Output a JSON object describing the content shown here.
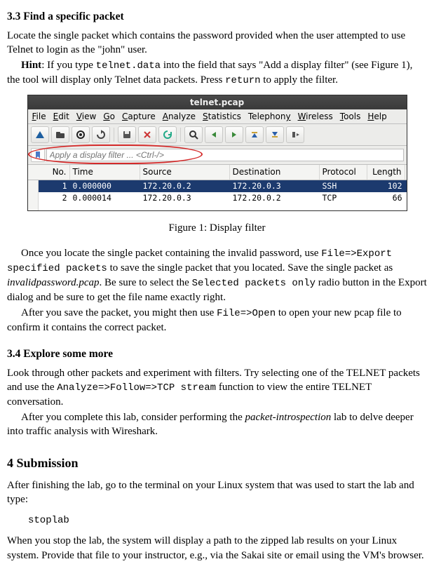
{
  "sec33": {
    "heading": "3.3   Find a specific packet",
    "p1a": "Locate the single packet which contains the password provided when the user attempted to use Telnet to login as the \"john\" user.",
    "p2_hint": "Hint",
    "p2a": ": If you type ",
    "p2_code": "telnet.data",
    "p2b": " into the field that says \"Add a display filter\" (see Figure 1), the tool will display only Telnet data packets. Press ",
    "p2_ret": "return",
    "p2c": " to apply the filter.",
    "p3a": "Once you locate the single packet containing the invalid password, use ",
    "p3_c1": "File=>Export specified packets",
    "p3b": " to save the single packet that you located.  Save the single packet as ",
    "p3_ital": "invalidpassword.pcap",
    "p3c": ".  Be sure to select the ",
    "p3_c2": "Selected packets only",
    "p3d": " radio button in the Export dialog and be sure to get the file name exactly right.",
    "p4a": "After you save the packet, you might then use ",
    "p4_c1": "File=>Open",
    "p4b": " to open your new pcap file to confirm it contains the correct packet."
  },
  "fig_caption": "Figure 1: Display filter",
  "sec34": {
    "heading": "3.4   Explore some more",
    "p1": "Look through other packets and experiment with filters. Try selecting one of the TELNET packets and use the ",
    "p1_c": "Analyze=>Follow=>TCP stream",
    "p1b": " function to view the entire TELNET conversation.",
    "p2a": "After you complete this lab, consider performing the ",
    "p2_ital": "packet-introspection",
    "p2b": " lab to delve deeper into traffic analysis with Wireshark."
  },
  "sec4": {
    "heading": "4    Submission",
    "p1": "After finishing the lab, go to the terminal on your Linux system that was used to start the lab and type:",
    "code": "stoplab",
    "p2": "When you stop the lab, the system will display a path to the zipped lab results on your Linux system. Provide that file to your instructor, e.g., via the Sakai site or email using the VM's browser."
  },
  "screenshot": {
    "title": "telnet.pcap",
    "menu": [
      "File",
      "Edit",
      "View",
      "Go",
      "Capture",
      "Analyze",
      "Statistics",
      "Telephony",
      "Wireless",
      "Tools",
      "Help"
    ],
    "filter_placeholder": "Apply a display filter ... <Ctrl-/>",
    "cols": {
      "no": "No.",
      "time": "Time",
      "src": "Source",
      "dst": "Destination",
      "prot": "Protocol",
      "len": "Length"
    },
    "rows": [
      {
        "no": "1",
        "time": "0.000000",
        "src": "172.20.0.2",
        "dst": "172.20.0.3",
        "prot": "SSH",
        "len": "102",
        "sel": true
      },
      {
        "no": "2",
        "time": "0.000014",
        "src": "172.20.0.3",
        "dst": "172.20.0.2",
        "prot": "TCP",
        "len": "66",
        "sel": false
      }
    ],
    "row3": {
      "no": "",
      "time": "",
      "src": "",
      "dst": "",
      "prot": "",
      "len": ""
    }
  }
}
